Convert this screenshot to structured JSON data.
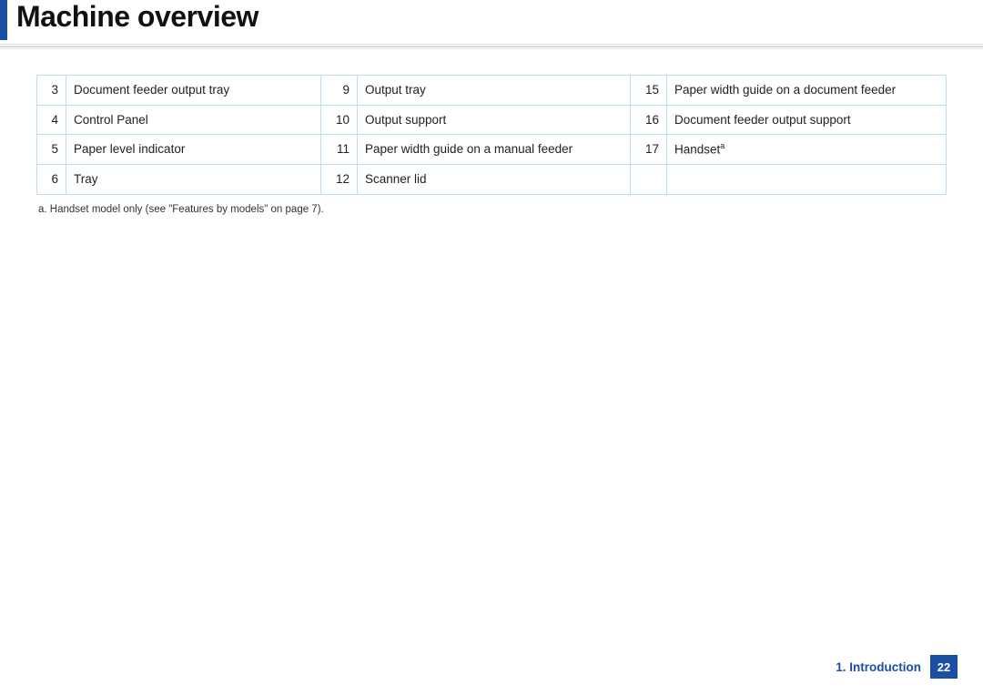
{
  "header": {
    "title": "Machine overview"
  },
  "table": {
    "rows": [
      {
        "c1n": "3",
        "c1t": "Document feeder output tray",
        "c2n": "9",
        "c2t": "Output tray",
        "c3n": "15",
        "c3t": "Paper width guide on a document feeder"
      },
      {
        "c1n": "4",
        "c1t": "Control Panel",
        "c2n": "10",
        "c2t": "Output support",
        "c3n": "16",
        "c3t": "Document feeder output support"
      },
      {
        "c1n": "5",
        "c1t": "Paper level indicator",
        "c2n": "11",
        "c2t": "Paper width guide on a manual feeder",
        "c3n": "17",
        "c3t": "Handset",
        "c3sup": "a"
      },
      {
        "c1n": "6",
        "c1t": "Tray",
        "c2n": "12",
        "c2t": "Scanner lid",
        "c3n": "",
        "c3t": ""
      }
    ]
  },
  "footnote": {
    "text": "a. Handset model only (see \"Features by models\" on page 7)."
  },
  "footer": {
    "chapter": "1.  Introduction",
    "page": "22"
  }
}
